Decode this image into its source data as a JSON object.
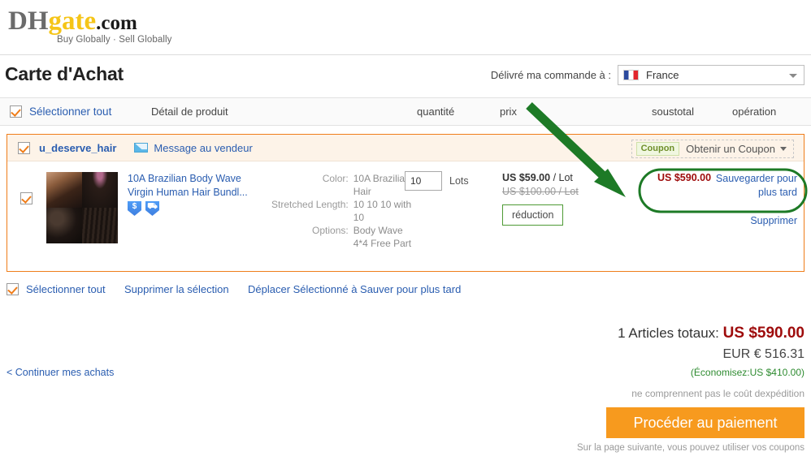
{
  "header": {
    "logo_dh": "DH",
    "logo_gate": "gate",
    "logo_com": ".com",
    "tagline": "Buy Globally · Sell Globally"
  },
  "page": {
    "title": "Carte d'Achat",
    "ship_to_label": "Délivré ma commande à :",
    "country": "France",
    "country_flag_icon": "flag-france-icon"
  },
  "cart_header": {
    "select_all": "Sélectionner tout",
    "detail": "Détail de produit",
    "quantity": "quantité",
    "price": "prix",
    "subtotal": "soustotal",
    "operation": "opération"
  },
  "seller": {
    "name": "u_deserve_hair",
    "message_label": "Message au vendeur",
    "message_icon": "envelope-icon",
    "coupon_tag": "Coupon",
    "coupon_label": "Obtenir un Coupon",
    "coupon_caret_icon": "chevron-down-icon"
  },
  "item": {
    "title": "10A Brazilian Body Wave Virgin Human Hair Bundl...",
    "badge1_icon": "dollar-shield-icon",
    "badge1_glyph": "$",
    "badge2_icon": "shipping-shield-icon",
    "badge2_glyph": "⛟",
    "attributes": [
      {
        "key": "Color:",
        "value": "10A Brazilian Hair"
      },
      {
        "key": "Stretched Length:",
        "value": "10 10 10 with 10"
      },
      {
        "key": "Options:",
        "value": "Body Wave 4*4 Free Part"
      }
    ],
    "quantity": "10",
    "quantity_unit": "Lots",
    "price_current": "US $59.00",
    "price_current_unit": "/ Lot",
    "price_old": "US $100.00 / Lot",
    "discount_button": "réduction",
    "subtotal": "US $590.00",
    "op_save_later": "Sauvegarder pour plus tard",
    "op_delete": "Supprimer"
  },
  "bottom_bar": {
    "select_all": "Sélectionner tout",
    "delete_selection": "Supprimer la sélection",
    "move_selection": "Déplacer Sélectionné à Sauver pour plus tard",
    "continue_shopping": "< Continuer mes achats"
  },
  "totals": {
    "items_label": "1 Articles totaux:",
    "items_amount": "US $590.00",
    "eur_line": "EUR €  516.31",
    "savings": "(Économisez:US $410.00)",
    "shipping_note": "ne comprennent pas le coût dexpédition",
    "checkout_button": "Procéder au paiement",
    "checkout_note": "Sur la page suivante, vous pouvez utiliser vos coupons"
  },
  "annotation": {
    "arrow_color": "#1d7a26",
    "highlight_color": "#1d7a26"
  }
}
